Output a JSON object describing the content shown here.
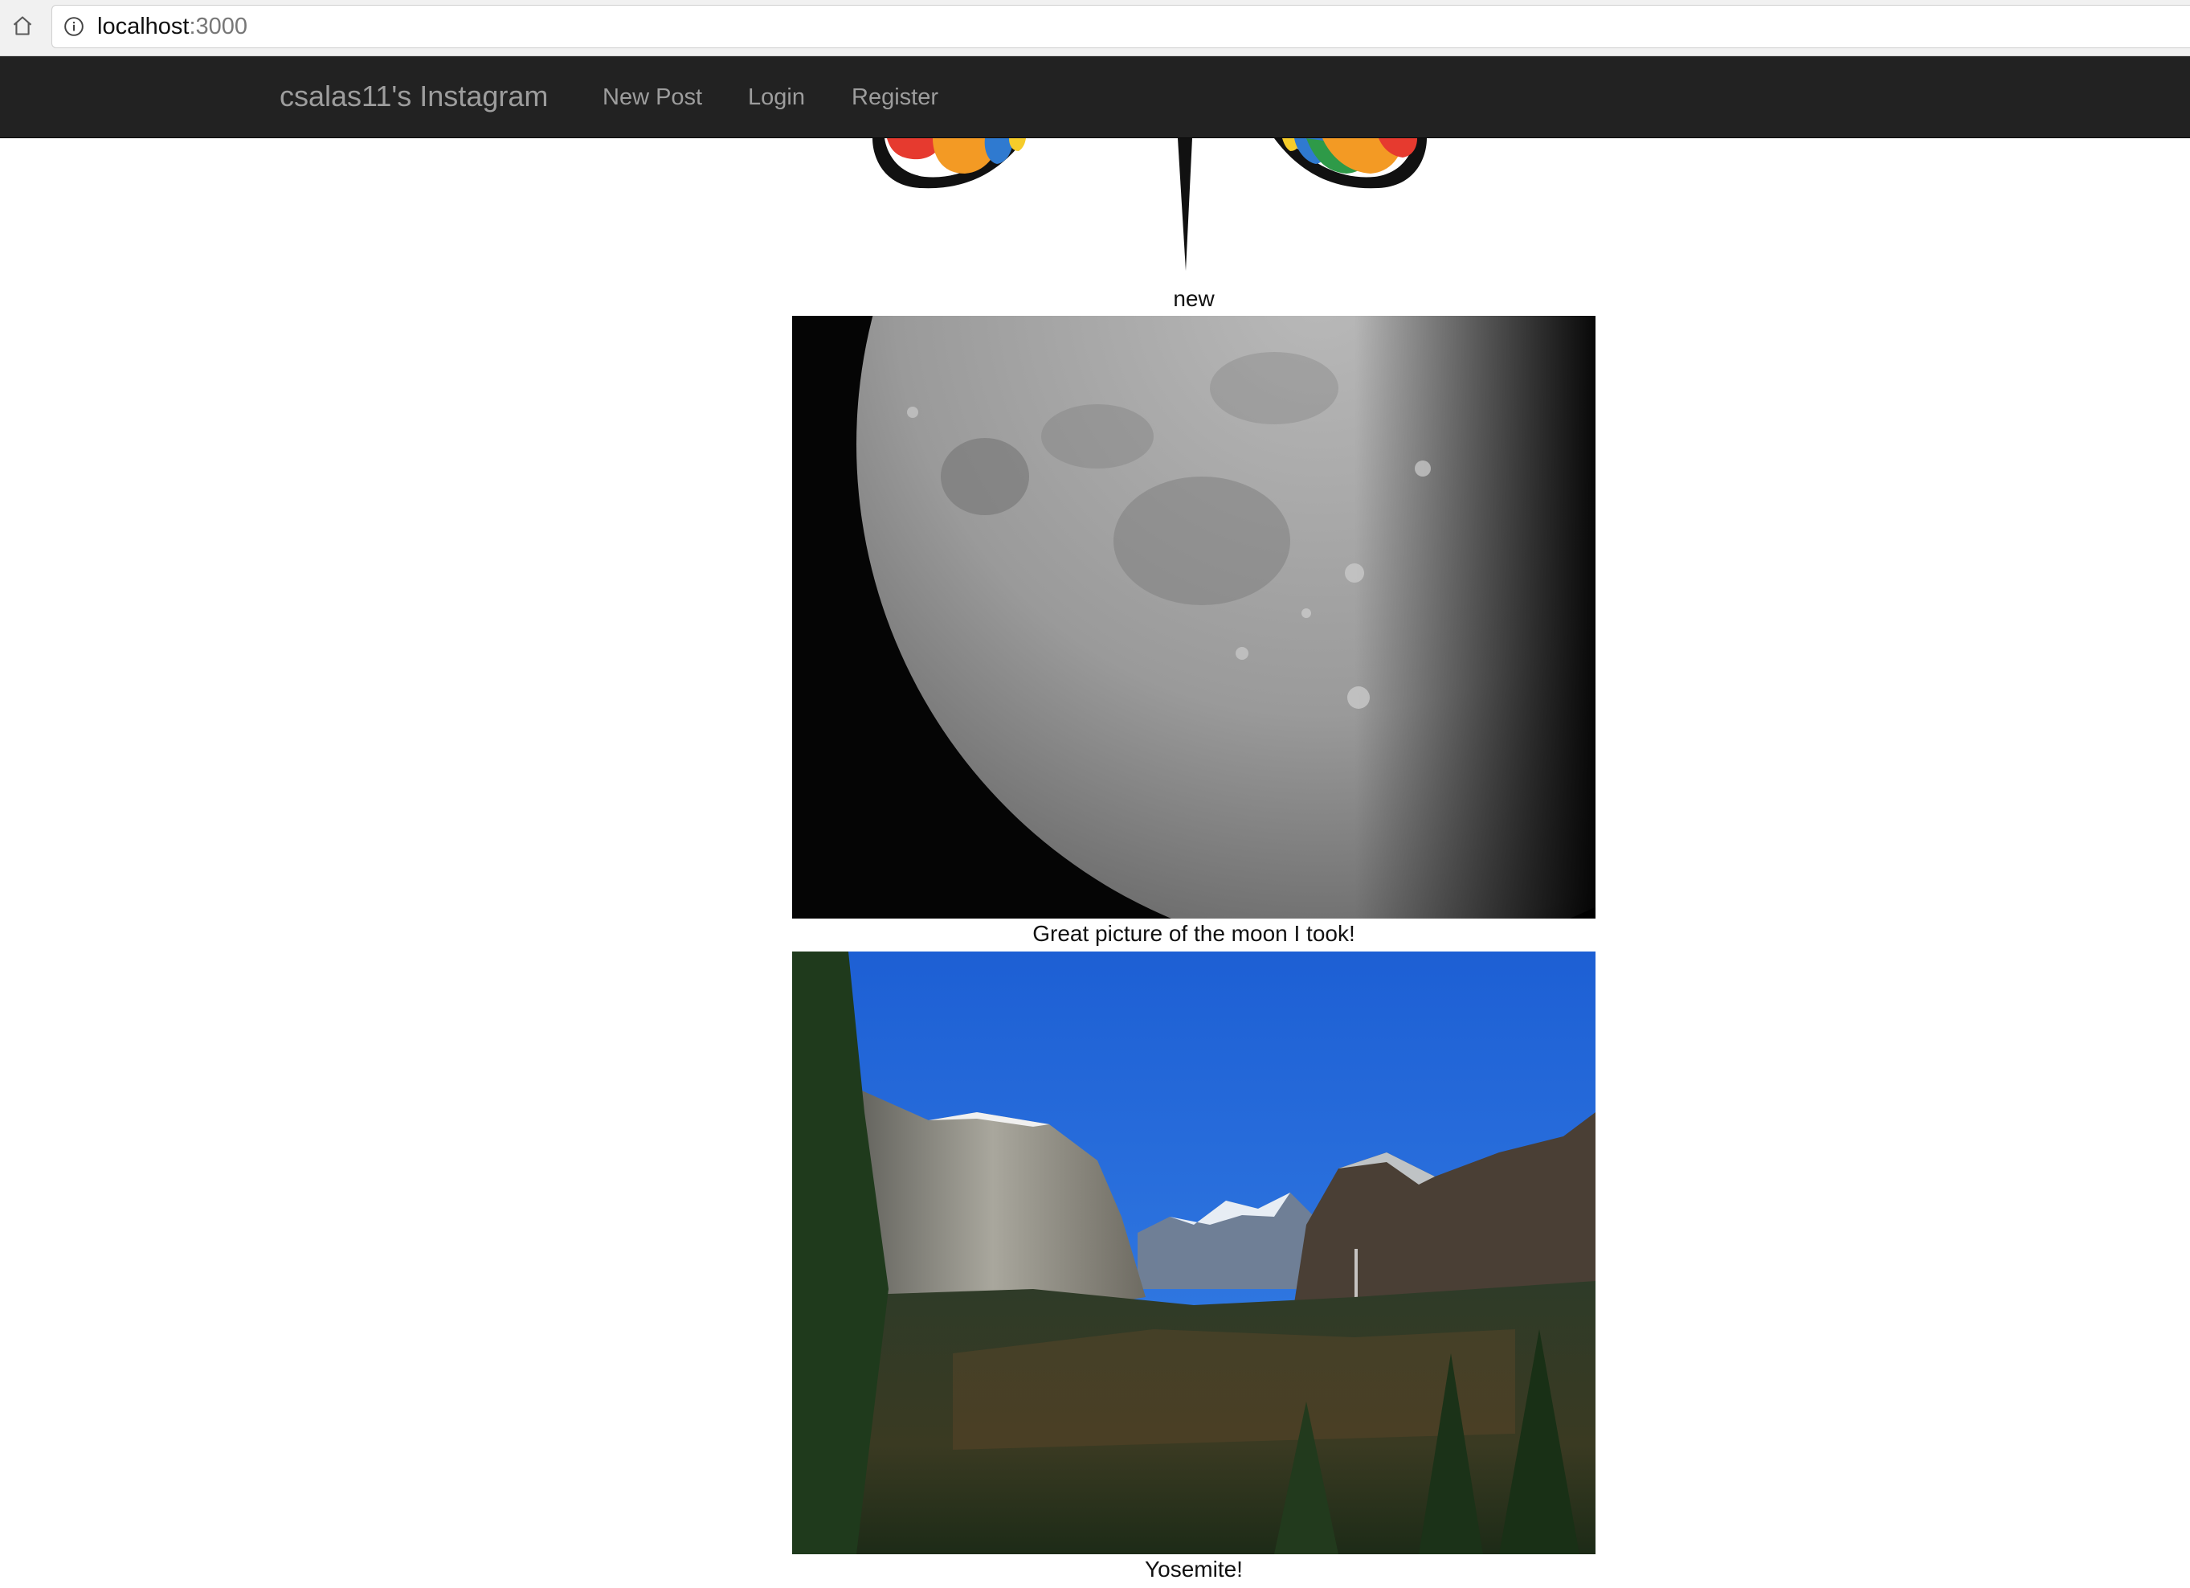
{
  "browser": {
    "url_host": "localhost",
    "url_port": ":3000",
    "home_icon": "home-icon",
    "info_icon": "info-icon"
  },
  "navbar": {
    "brand": "csalas11's Instagram",
    "links": [
      "New Post",
      "Login",
      "Register"
    ],
    "background": "#222222",
    "link_color": "#9d9d9d"
  },
  "posts": [
    {
      "caption": "new",
      "image": "butterfly-logo-image"
    },
    {
      "caption": "Great picture of the moon I took!",
      "image": "moon-photo"
    },
    {
      "caption": "Yosemite!",
      "image": "yosemite-photo"
    }
  ]
}
